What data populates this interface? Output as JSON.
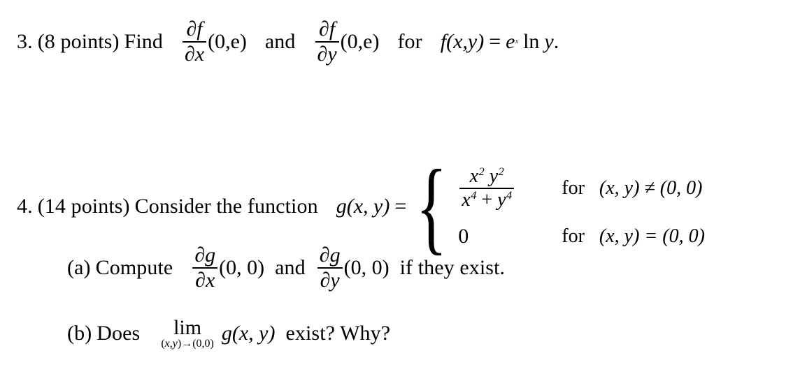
{
  "document": {
    "type": "math-exam-questions",
    "background_color": "#ffffff",
    "text_color": "#000000"
  },
  "questions": [
    {
      "id": "q3",
      "number": "3.",
      "points_label": "(8 points)",
      "verb": "Find",
      "derivative_1": {
        "numerator": "∂f",
        "denominator": "∂x",
        "point": "(0,e)"
      },
      "conjunction": "and",
      "derivative_2": {
        "numerator": "∂f",
        "denominator": "∂y",
        "point": "(0,e)"
      },
      "for_label": "for",
      "function_def": {
        "name": "f",
        "args": "(x,y)",
        "equals": "=",
        "base": "e",
        "exponent": "x",
        "log": "ln",
        "log_arg": "y",
        "period": "."
      }
    },
    {
      "id": "q4",
      "number": "4.",
      "points_label": "(14 points)",
      "verb": "Consider the function",
      "function_name": "g",
      "function_args": "(x, y)",
      "equals": "=",
      "piecewise": {
        "brace": "{",
        "cases": [
          {
            "value_type": "fraction",
            "numerator": "x²y²",
            "numerator_parts": [
              {
                "base": "x",
                "exp": "2"
              },
              {
                "base": "y",
                "exp": "2"
              }
            ],
            "denominator_parts": [
              {
                "base": "x",
                "exp": "4"
              },
              {
                "op": "+"
              },
              {
                "base": "y",
                "exp": "4"
              }
            ],
            "denominator": "x⁴ + y⁴",
            "condition_prefix": "for",
            "condition": "(x, y) ≠ (0, 0)"
          },
          {
            "value_type": "constant",
            "value": "0",
            "condition_prefix": "for",
            "condition": "(x, y) = (0, 0)"
          }
        ]
      },
      "parts": [
        {
          "label": "(a)",
          "verb": "Compute",
          "derivative_1": {
            "numerator": "∂g",
            "denominator": "∂x",
            "point": "(0, 0)"
          },
          "conjunction": "and",
          "derivative_2": {
            "numerator": "∂g",
            "denominator": "∂y",
            "point": "(0, 0)"
          },
          "tail": "if they exist."
        },
        {
          "label": "(b)",
          "verb": "Does",
          "limit": {
            "operator": "lim",
            "subscript_open": "(",
            "subscript_vars": "x,y",
            "subscript_close": ")",
            "arrow": "→",
            "subscript_target": "(0,0)"
          },
          "function_expr": "g(x, y)",
          "tail": "exist? Why?"
        }
      ]
    }
  ]
}
